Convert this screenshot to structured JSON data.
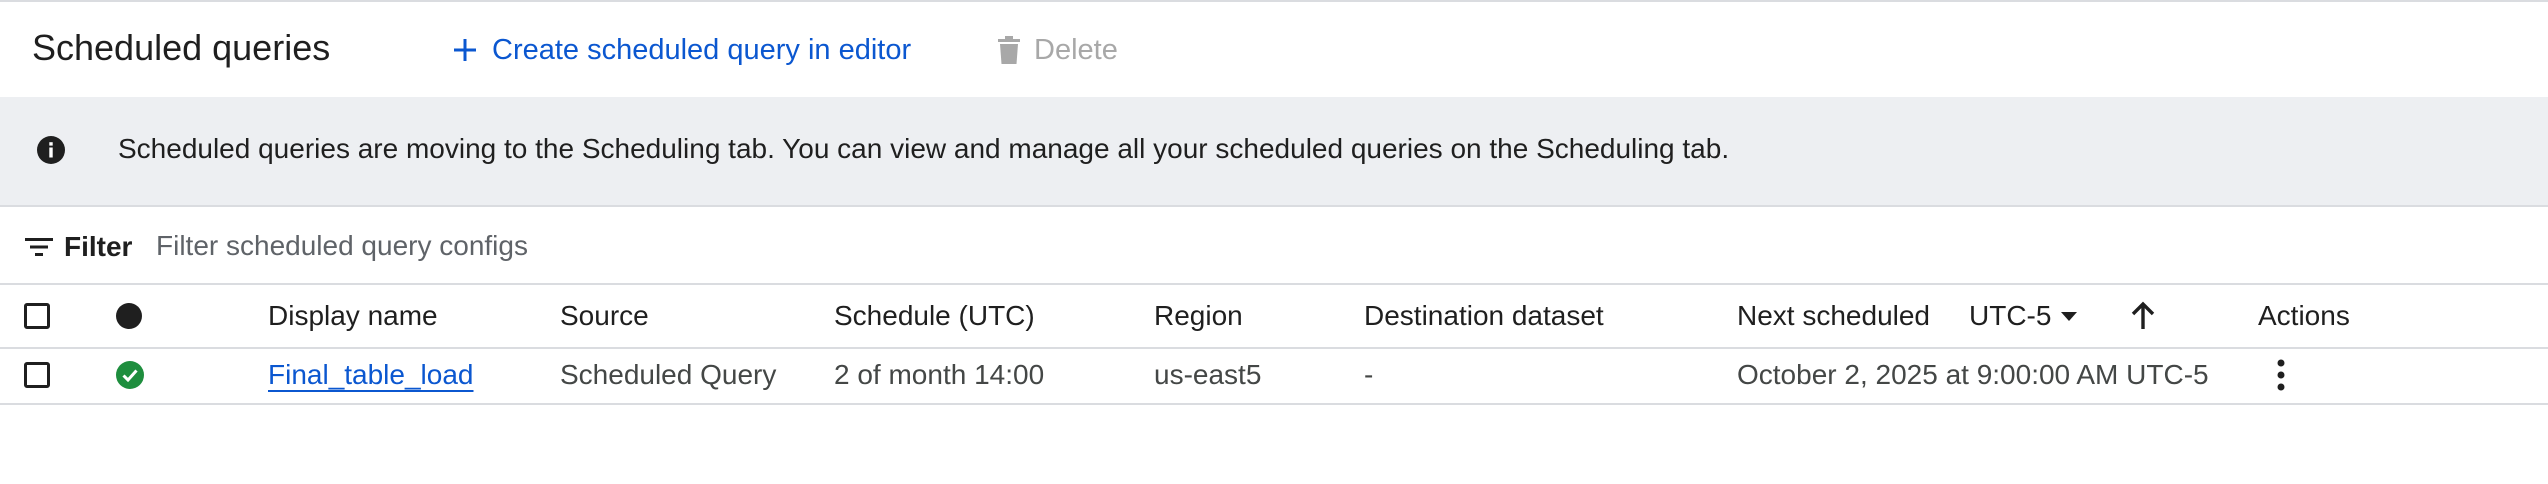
{
  "header": {
    "title": "Scheduled queries",
    "create_label": "Create scheduled query in editor",
    "delete_label": "Delete"
  },
  "banner": {
    "message": "Scheduled queries are moving to the Scheduling tab. You can view and manage all your scheduled queries on the Scheduling tab."
  },
  "filter": {
    "label": "Filter",
    "placeholder": "Filter scheduled query configs"
  },
  "table": {
    "columns": {
      "display_name": "Display name",
      "source": "Source",
      "schedule": "Schedule (UTC)",
      "region": "Region",
      "destination": "Destination dataset",
      "next_scheduled": "Next scheduled",
      "timezone": "UTC-5",
      "actions": "Actions"
    },
    "rows": [
      {
        "status": "success",
        "display_name": "Final_table_load",
        "source": "Scheduled Query",
        "schedule": "2 of month 14:00",
        "region": "us-east5",
        "destination": "-",
        "next_scheduled": "October 2, 2025 at 9:00:00 AM UTC-5"
      }
    ]
  },
  "colors": {
    "accent": "#0b57d0",
    "success": "#1e8e3e",
    "banner_bg": "#edeff2",
    "disabled": "#a8a8a8"
  },
  "icons": {
    "create": "plus-icon",
    "delete": "trash-icon",
    "info": "info-icon",
    "filter": "filter-lines-icon",
    "sort": "arrow-up-icon",
    "actions": "more-vert-icon",
    "status": "check-circle-icon"
  }
}
